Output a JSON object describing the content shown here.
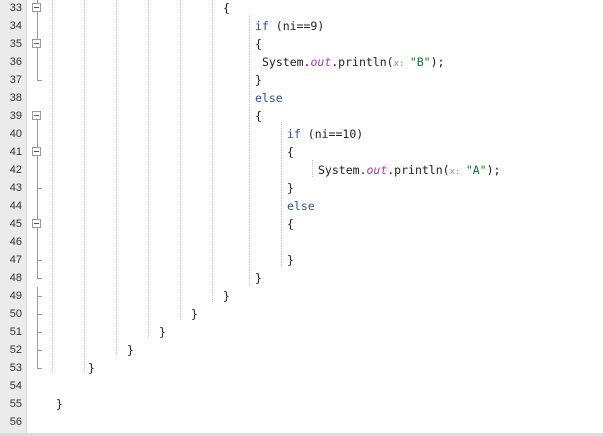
{
  "editor": {
    "lines": [
      {
        "num": "33",
        "indent": 223,
        "fold": "box",
        "tokens": [
          {
            "t": "{",
            "c": "p"
          }
        ]
      },
      {
        "num": "34",
        "indent": 255,
        "fold": "",
        "tokens": [
          {
            "t": "if",
            "c": "kw"
          },
          {
            "t": " (ni==9)",
            "c": "p"
          }
        ]
      },
      {
        "num": "35",
        "indent": 255,
        "fold": "box",
        "tokens": [
          {
            "t": "{",
            "c": "p"
          }
        ]
      },
      {
        "num": "36",
        "indent": 262,
        "fold": "",
        "tokens": [
          {
            "t": "System.",
            "c": "p"
          },
          {
            "t": "out",
            "c": "fld"
          },
          {
            "t": ".println(",
            "c": "p"
          },
          {
            "t": "x: ",
            "c": "hint"
          },
          {
            "t": "\"B\"",
            "c": "str"
          },
          {
            "t": ");",
            "c": "p"
          }
        ]
      },
      {
        "num": "37",
        "indent": 255,
        "fold": "tick",
        "tokens": [
          {
            "t": "}",
            "c": "p"
          }
        ]
      },
      {
        "num": "38",
        "indent": 255,
        "fold": "",
        "tokens": [
          {
            "t": "else",
            "c": "kw"
          }
        ]
      },
      {
        "num": "39",
        "indent": 255,
        "fold": "box",
        "tokens": [
          {
            "t": "{",
            "c": "p"
          }
        ]
      },
      {
        "num": "40",
        "indent": 287,
        "fold": "",
        "tokens": [
          {
            "t": "if",
            "c": "kw"
          },
          {
            "t": " (ni==10)",
            "c": "p"
          }
        ]
      },
      {
        "num": "41",
        "indent": 287,
        "fold": "box",
        "tokens": [
          {
            "t": "{",
            "c": "p"
          }
        ]
      },
      {
        "num": "42",
        "indent": 318,
        "fold": "",
        "tokens": [
          {
            "t": "System.",
            "c": "p"
          },
          {
            "t": "out",
            "c": "fld"
          },
          {
            "t": ".println(",
            "c": "p"
          },
          {
            "t": "x: ",
            "c": "hint"
          },
          {
            "t": "\"A\"",
            "c": "str"
          },
          {
            "t": ");",
            "c": "p"
          }
        ]
      },
      {
        "num": "43",
        "indent": 287,
        "fold": "tick",
        "tokens": [
          {
            "t": "}",
            "c": "p"
          }
        ]
      },
      {
        "num": "44",
        "indent": 287,
        "fold": "",
        "tokens": [
          {
            "t": "else",
            "c": "kw"
          }
        ]
      },
      {
        "num": "45",
        "indent": 287,
        "fold": "box",
        "tokens": [
          {
            "t": "{",
            "c": "p"
          }
        ]
      },
      {
        "num": "46",
        "indent": 0,
        "fold": "",
        "tokens": []
      },
      {
        "num": "47",
        "indent": 287,
        "fold": "tick",
        "tokens": [
          {
            "t": "}",
            "c": "p"
          }
        ]
      },
      {
        "num": "48",
        "indent": 255,
        "fold": "tick",
        "tokens": [
          {
            "t": "}",
            "c": "p"
          }
        ]
      },
      {
        "num": "49",
        "indent": 223,
        "fold": "tick",
        "tokens": [
          {
            "t": "}",
            "c": "p"
          }
        ]
      },
      {
        "num": "50",
        "indent": 191,
        "fold": "tick",
        "tokens": [
          {
            "t": "}",
            "c": "p"
          }
        ]
      },
      {
        "num": "51",
        "indent": 159,
        "fold": "tick",
        "tokens": [
          {
            "t": "}",
            "c": "p"
          }
        ]
      },
      {
        "num": "52",
        "indent": 127,
        "fold": "tick",
        "tokens": [
          {
            "t": "}",
            "c": "p"
          }
        ]
      },
      {
        "num": "53",
        "indent": 88,
        "fold": "tick",
        "tokens": [
          {
            "t": "}",
            "c": "p"
          }
        ]
      },
      {
        "num": "54",
        "indent": 0,
        "fold": "",
        "tokens": []
      },
      {
        "num": "55",
        "indent": 56,
        "fold": "",
        "tokens": [
          {
            "t": "}",
            "c": "p"
          }
        ]
      },
      {
        "num": "56",
        "indent": 0,
        "fold": "",
        "tokens": []
      }
    ]
  },
  "colors": {
    "keyword": "#2a50a8",
    "field": "#a33cb8",
    "string": "#0a7a2a",
    "hint": "#8c8c8c",
    "gutter": "#ebebeb"
  }
}
